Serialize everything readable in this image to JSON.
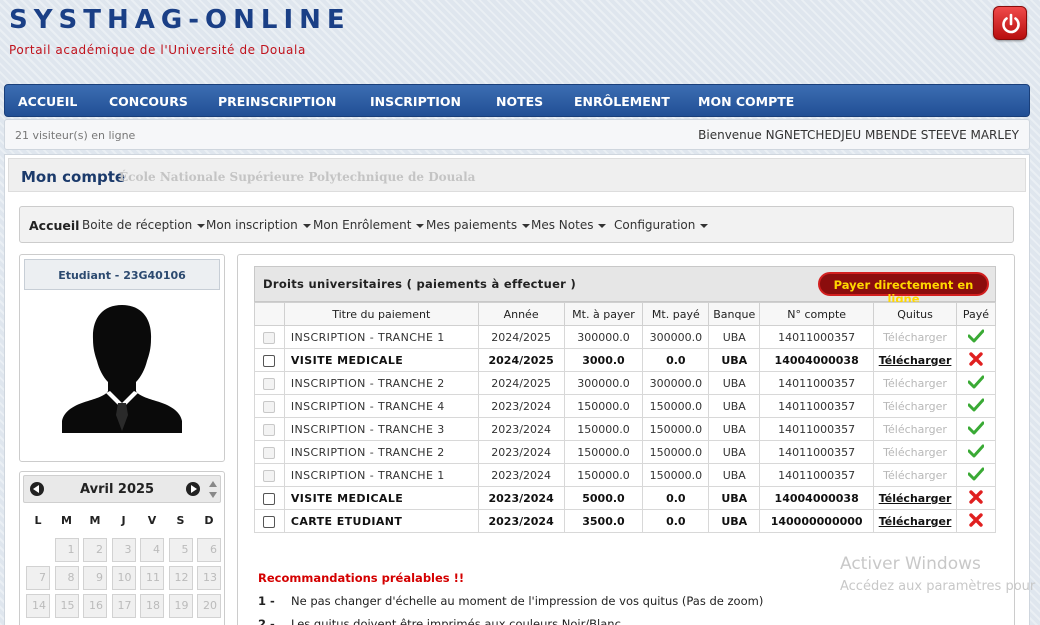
{
  "app": {
    "brand": "SYSTHAG-ONLINE",
    "subtitle": "Portail académique de l'Université de Douala"
  },
  "nav": [
    "ACCUEIL",
    "CONCOURS",
    "PREINSCRIPTION",
    "INSCRIPTION",
    "NOTES",
    "ENRÔLEMENT",
    "MON COMPTE"
  ],
  "status": {
    "visitors": "21 visiteur(s) en ligne",
    "welcome": "Bienvenue NGNETCHEDJEU MBENDE STEEVE MARLEY"
  },
  "page": {
    "title": "Mon compte",
    "school": "École Nationale Supérieure Polytechnique de Douala"
  },
  "subnav": [
    "Accueil",
    "Boite de réception",
    "Mon inscription",
    "Mon Enrôlement",
    "Mes paiements",
    "Mes Notes",
    "Configuration"
  ],
  "student": {
    "label": "Etudiant - 23G40106"
  },
  "calendar": {
    "month": "Avril 2025",
    "days_of_week": [
      "L",
      "M",
      "M",
      "J",
      "V",
      "S",
      "D"
    ],
    "visible_days": [
      "",
      "1",
      "2",
      "3",
      "4",
      "5",
      "6",
      "7",
      "8",
      "9",
      "10",
      "11",
      "12",
      "13",
      "14",
      "15",
      "16",
      "17",
      "18",
      "19",
      "20"
    ]
  },
  "payments": {
    "title": "Droits universitaires ( paiements à effectuer )",
    "pay_button": "Payer directement en ligne",
    "columns": [
      "Titre du paiement",
      "Année",
      "Mt. à payer",
      "Mt. payé",
      "Banque",
      "N° compte",
      "Quitus",
      "Payé"
    ],
    "rows": [
      {
        "title": "INSCRIPTION - TRANCHE 1",
        "year": "2024/2025",
        "due": "300000.0",
        "paid": "300000.0",
        "bank": "UBA",
        "account": "14011000357",
        "quitus": "Télécharger",
        "is_paid": true
      },
      {
        "title": "VISITE MEDICALE",
        "year": "2024/2025",
        "due": "3000.0",
        "paid": "0.0",
        "bank": "UBA",
        "account": "14004000038",
        "quitus": "Télécharger",
        "is_paid": false
      },
      {
        "title": "INSCRIPTION - TRANCHE 2",
        "year": "2024/2025",
        "due": "300000.0",
        "paid": "300000.0",
        "bank": "UBA",
        "account": "14011000357",
        "quitus": "Télécharger",
        "is_paid": true
      },
      {
        "title": "INSCRIPTION - TRANCHE 4",
        "year": "2023/2024",
        "due": "150000.0",
        "paid": "150000.0",
        "bank": "UBA",
        "account": "14011000357",
        "quitus": "Télécharger",
        "is_paid": true
      },
      {
        "title": "INSCRIPTION - TRANCHE 3",
        "year": "2023/2024",
        "due": "150000.0",
        "paid": "150000.0",
        "bank": "UBA",
        "account": "14011000357",
        "quitus": "Télécharger",
        "is_paid": true
      },
      {
        "title": "INSCRIPTION - TRANCHE 2",
        "year": "2023/2024",
        "due": "150000.0",
        "paid": "150000.0",
        "bank": "UBA",
        "account": "14011000357",
        "quitus": "Télécharger",
        "is_paid": true
      },
      {
        "title": "INSCRIPTION - TRANCHE 1",
        "year": "2023/2024",
        "due": "150000.0",
        "paid": "150000.0",
        "bank": "UBA",
        "account": "14011000357",
        "quitus": "Télécharger",
        "is_paid": true
      },
      {
        "title": "VISITE MEDICALE",
        "year": "2023/2024",
        "due": "5000.0",
        "paid": "0.0",
        "bank": "UBA",
        "account": "14004000038",
        "quitus": "Télécharger",
        "is_paid": false
      },
      {
        "title": "CARTE ETUDIANT",
        "year": "2023/2024",
        "due": "3500.0",
        "paid": "0.0",
        "bank": "UBA",
        "account": "140000000000",
        "quitus": "Télécharger",
        "is_paid": false
      }
    ]
  },
  "recommendations": {
    "title": "Recommandations préalables !!",
    "items": [
      {
        "num": "1 -",
        "text": "Ne pas changer d'échelle au moment de l'impression de vos quitus (Pas de zoom)"
      },
      {
        "num": "2 -",
        "text": "Les quitus doivent être imprimés aux couleurs Noir/Blanc"
      }
    ]
  },
  "watermark": {
    "line1": "Activer Windows",
    "line2": "Accédez aux paramètres pour"
  },
  "colors": {
    "brand": "#1a3f86",
    "nav": "#2a5aa0",
    "subtitle": "#c0121c",
    "paid_check": "#3aaa35",
    "unpaid_cross": "#e02020"
  }
}
